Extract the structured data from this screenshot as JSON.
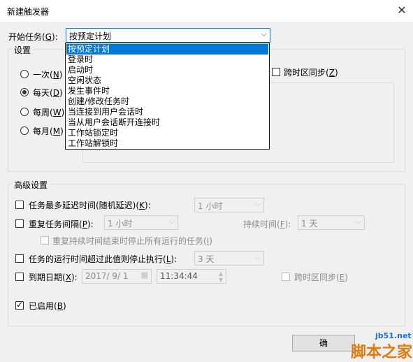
{
  "window": {
    "title": "新建触发器"
  },
  "start_task": {
    "label": "开始任务",
    "accel": "G",
    "value": "按预定计划",
    "options": [
      "按预定计划",
      "登录时",
      "启动时",
      "空闲状态",
      "发生事件时",
      "创建/修改任务时",
      "当连接到用户会话时",
      "当从用户会话断开连接时",
      "工作站锁定时",
      "工作站解锁时"
    ]
  },
  "settings": {
    "label": "设置",
    "radios": [
      {
        "label": "一次",
        "accel": "N",
        "checked": false
      },
      {
        "label": "每天",
        "accel": "D",
        "checked": true
      },
      {
        "label": "每周",
        "accel": "W",
        "checked": false
      },
      {
        "label": "每月",
        "accel": "M",
        "checked": false
      }
    ],
    "sync_tz": {
      "label": "跨时区同步",
      "accel": "Z",
      "checked": false
    }
  },
  "advanced": {
    "label": "高级设置",
    "delay": {
      "label": "任务最多延迟时间(随机延迟)",
      "accel": "K",
      "value": "1 小时",
      "checked": false
    },
    "repeat": {
      "label": "重复任务间隔",
      "accel": "P",
      "value": "1 小时",
      "checked": false,
      "duration_label": "持续时间",
      "duration_accel": "F",
      "duration_value": "1 天",
      "stop_label": "重复持续时间结束时停止所有运行的任务",
      "stop_accel": "I"
    },
    "stop_if": {
      "label": "任务的运行时间超过此值则停止执行",
      "accel": "L",
      "value": "3 天",
      "checked": false
    },
    "expire": {
      "label": "到期日期",
      "accel": "X",
      "date": "2017/ 9/ 1",
      "time": "11:34:44",
      "checked": false,
      "sync_label": "跨时区同步",
      "sync_accel": "E"
    },
    "enabled": {
      "label": "已启用",
      "accel": "B",
      "checked": true
    }
  },
  "buttons": {
    "ok": "确"
  },
  "watermark": {
    "site": "jb51.net",
    "brand": "脚本之家"
  }
}
